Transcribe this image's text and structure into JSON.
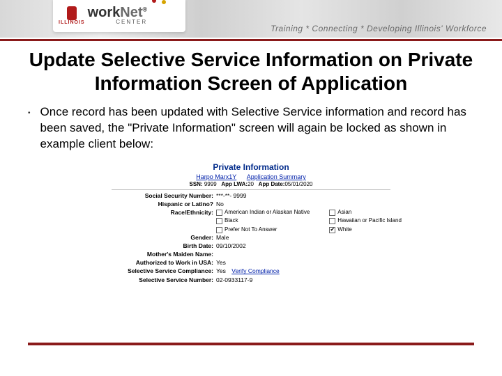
{
  "header": {
    "logo_state": "ILLINOIS",
    "logo_main_a": "work",
    "logo_main_b": "Net",
    "logo_sub": "CENTER",
    "tagline": "Training * Connecting * Developing Illinois' Workforce"
  },
  "title": "Update Selective Service Information on Private Information Screen of Application",
  "bullet1": "Once record has been updated with Selective Service information and record has been saved, the \"Private Information\" screen will again be locked as shown in example client below:",
  "panel": {
    "heading": "Private Information",
    "link_name": "Harpo Marx1Y",
    "link_summary": "Application Summary",
    "summary_ssn_label": "SSN:",
    "summary_ssn": "9999",
    "summary_lwa_label": "App LWA:",
    "summary_lwa": "20",
    "summary_date_label": "App Date:",
    "summary_date": "05/01/2020",
    "fields": {
      "ssn_label": "Social Security Number:",
      "ssn_val": "***-**- 9999",
      "hisp_label": "Hispanic or Latino?",
      "hisp_val": "No",
      "race_label": "Race/Ethnicity:",
      "gender_label": "Gender:",
      "gender_val": "Male",
      "birth_label": "Birth Date:",
      "birth_val": "09/10/2002",
      "maiden_label": "Mother's Maiden Name:",
      "maiden_val": "",
      "auth_label": "Authorized to Work in USA:",
      "auth_val": "Yes",
      "comp_label": "Selective Service Compliance:",
      "comp_val": "Yes",
      "comp_link": "Verify Compliance",
      "num_label": "Selective Service Number:",
      "num_val": "02-0933117-9"
    },
    "checkboxes": {
      "aian": "American Indian or Alaskan Native",
      "black": "Black",
      "pna": "Prefer Not To Answer",
      "asian": "Asian",
      "hpi": "Hawaiian or Pacific Island",
      "white": "White"
    }
  }
}
